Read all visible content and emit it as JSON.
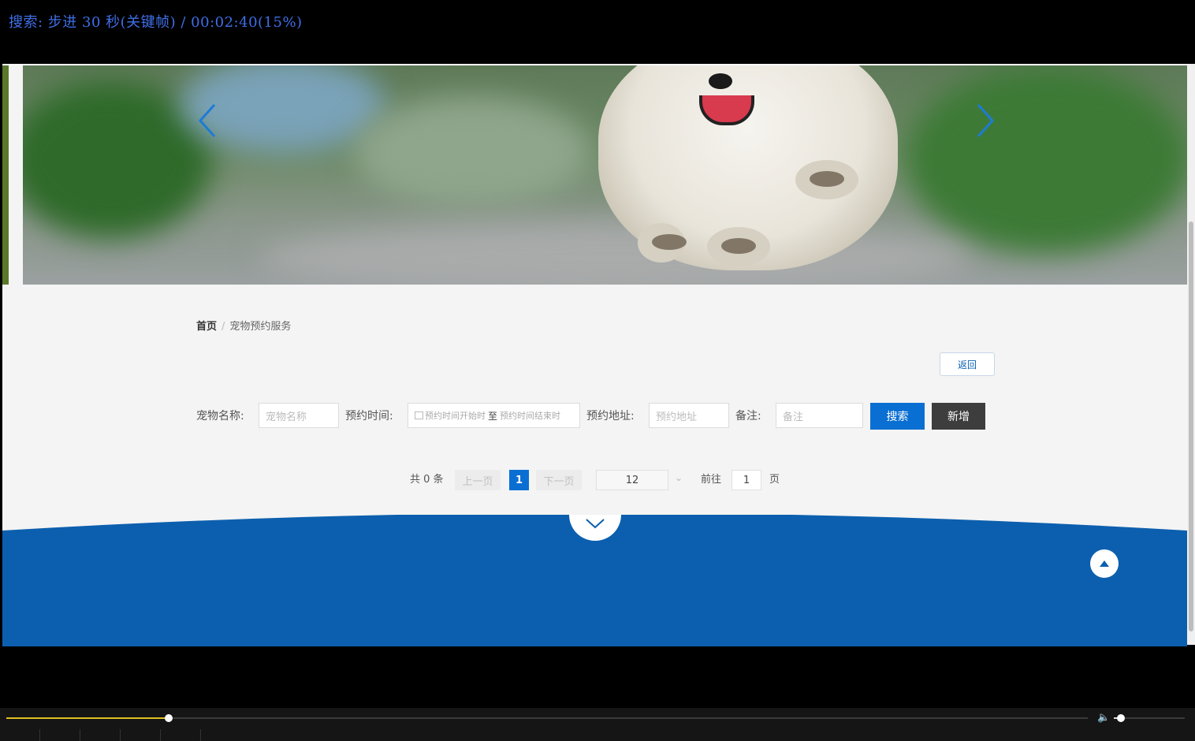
{
  "osd": {
    "text": "搜索: 步进 30 秒(关键帧) / 00:02:40(15%)"
  },
  "banner": {
    "prev_icon": "chevron-left-icon",
    "next_icon": "chevron-right-icon"
  },
  "breadcrumb": {
    "home": "首页",
    "separator": "/",
    "current": "宠物预约服务"
  },
  "actions": {
    "back_label": "返回"
  },
  "search_form": {
    "pet_name_label": "宠物名称:",
    "pet_name_placeholder": "宠物名称",
    "time_label": "预约时间:",
    "time_start_placeholder": "预约时间开始时",
    "time_to": "至",
    "time_end_placeholder": "预约时间结束时",
    "address_label": "预约地址:",
    "address_placeholder": "预约地址",
    "note_label": "备注:",
    "note_placeholder": "备注",
    "search_label": "搜索",
    "add_label": "新增"
  },
  "pagination": {
    "total": "共 0 条",
    "prev": "上一页",
    "current": "1",
    "next": "下一页",
    "page_size": "12",
    "goto_prefix": "前往",
    "goto_value": "1",
    "goto_suffix": "页"
  },
  "colors": {
    "primary": "#0a6fd2",
    "footer": "#0c5fae",
    "osd": "#3f6fe8",
    "seek": "#e0c020"
  },
  "player": {
    "progress": 0.15,
    "volume": 0.1
  }
}
